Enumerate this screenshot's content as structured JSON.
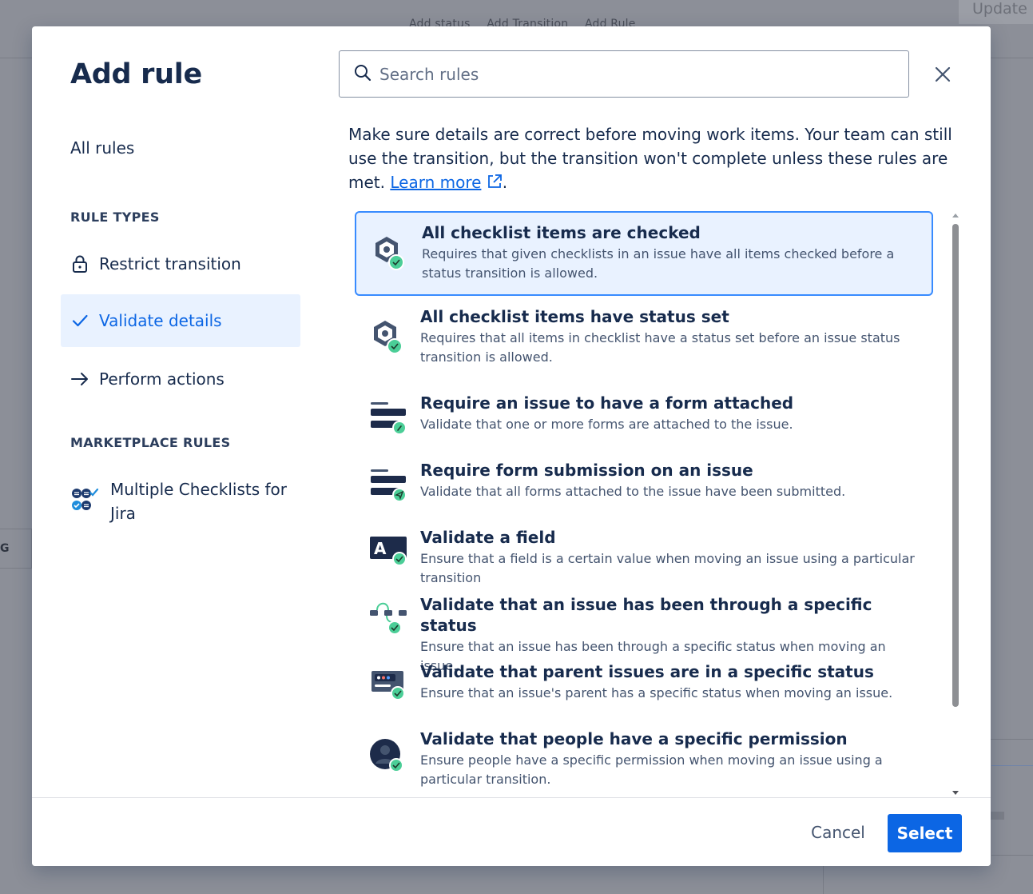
{
  "background": {
    "tabs": [
      "Add status",
      "Add Transition",
      "Add Rule"
    ],
    "update_label": "Update",
    "left_fragment": "G"
  },
  "modal": {
    "title": "Add rule",
    "all_rules": "All rules",
    "sections": {
      "rule_types": "RULE TYPES",
      "marketplace": "MARKETPLACE RULES"
    },
    "nav": {
      "restrict": "Restrict transition",
      "validate": "Validate details",
      "perform": "Perform actions",
      "marketplace_item": "Multiple Checklists for Jira"
    },
    "search": {
      "placeholder": "Search rules",
      "value": ""
    },
    "description": {
      "text": "Make sure details are correct before moving work items. Your team can still use the transition, but the transition won't complete unless these rules are met. ",
      "link": "Learn more",
      "suffix": "."
    },
    "rules": [
      {
        "title": "All checklist items are checked",
        "desc": "Requires that given checklists in an issue have all items checked before a status transition is allowed.",
        "icon": "checklist-hex-icon"
      },
      {
        "title": "All checklist items have status set",
        "desc": "Requires that all items in checklist have a status set before an issue status transition is allowed.",
        "icon": "checklist-hex-icon"
      },
      {
        "title": "Require an issue to have a form attached",
        "desc": "Validate that one or more forms are attached to the issue.",
        "icon": "form-attach-icon"
      },
      {
        "title": "Require form submission on an issue",
        "desc": "Validate that all forms attached to the issue have been submitted.",
        "icon": "form-submit-icon"
      },
      {
        "title": "Validate a field",
        "desc": "Ensure that a field is a certain value when moving an issue using a particular transition",
        "icon": "field-icon"
      },
      {
        "title": "Validate that an issue has been through a specific status",
        "desc": "Ensure that an issue has been through a specific status when moving an issue.",
        "icon": "status-path-icon"
      },
      {
        "title": "Validate that parent issues are in a specific status",
        "desc": "Ensure that an issue's parent has a specific status when moving an issue.",
        "icon": "parent-status-icon"
      },
      {
        "title": "Validate that people have a specific permission",
        "desc": "Ensure people have a specific permission when moving an issue using a particular transition.",
        "icon": "person-permission-icon"
      }
    ],
    "footer": {
      "cancel": "Cancel",
      "select": "Select"
    },
    "colors": {
      "primary": "#0c66e4",
      "selected_bg": "#e9f2ff",
      "selected_border": "#388bff",
      "check_green": "#4bce97"
    }
  }
}
